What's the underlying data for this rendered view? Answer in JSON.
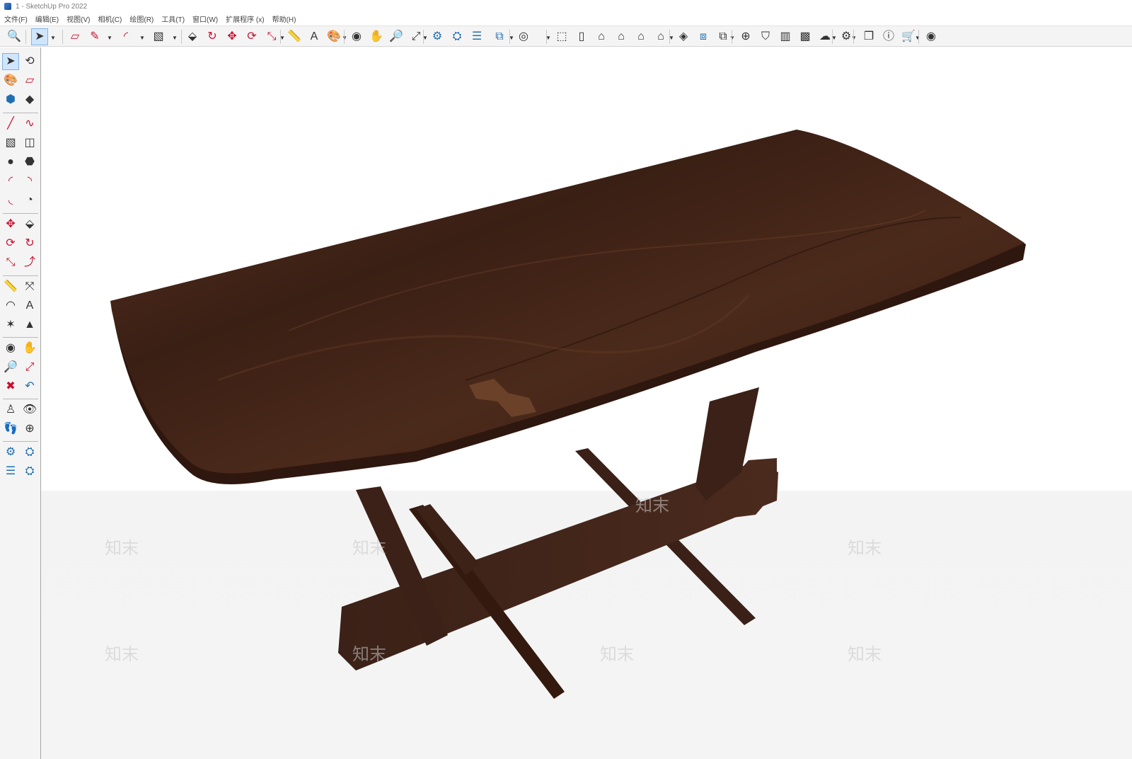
{
  "window": {
    "title": "1 - SketchUp Pro 2022"
  },
  "menu": [
    "文件(F)",
    "编辑(E)",
    "视图(V)",
    "相机(C)",
    "绘图(R)",
    "工具(T)",
    "窗口(W)",
    "扩展程序 (x)",
    "帮助(H)"
  ],
  "colors": {
    "toolbar_bg": "#f4f4f4",
    "active_tool": "#cfe5fb",
    "wood_top": "#4a2a1c",
    "wood_leg": "#3c2218",
    "icon_red": "#c8102e",
    "icon_blue": "#1f6fb2"
  },
  "toolbar": [
    {
      "icon": "zoom-extents-icon",
      "glyph": "🔍"
    },
    {
      "icon": "select-icon",
      "glyph": "➤"
    },
    {
      "icon": "eraser-icon",
      "glyph": "▱"
    },
    {
      "icon": "pencil-icon",
      "glyph": "✎"
    },
    {
      "icon": "arc-icon",
      "glyph": "◜"
    },
    {
      "icon": "rectangle-icon",
      "glyph": "▧"
    },
    {
      "icon": "push-pull-icon",
      "glyph": "⬙"
    },
    {
      "icon": "follow-me-icon",
      "glyph": "↻"
    },
    {
      "icon": "move-icon",
      "glyph": "✥"
    },
    {
      "icon": "rotate-icon",
      "glyph": "⟳"
    },
    {
      "icon": "scale-icon",
      "glyph": "⤡"
    },
    {
      "icon": "tape-measure-icon",
      "glyph": "📏"
    },
    {
      "icon": "text-icon",
      "glyph": "A"
    },
    {
      "icon": "paint-bucket-icon",
      "glyph": "🎨"
    },
    {
      "icon": "orbit-icon",
      "glyph": "◉"
    },
    {
      "icon": "pan-icon",
      "glyph": "✋"
    },
    {
      "icon": "zoom-icon",
      "glyph": "🔎"
    },
    {
      "icon": "zoom-window-icon",
      "glyph": "⤢"
    },
    {
      "icon": "warehouse-icon",
      "glyph": "⚙"
    },
    {
      "icon": "extension-warehouse-icon",
      "glyph": "⛭"
    },
    {
      "icon": "layout-icon",
      "glyph": "☰"
    },
    {
      "icon": "styles-icon",
      "glyph": "⧉"
    },
    {
      "icon": "account-icon",
      "glyph": "◎"
    },
    {
      "icon": "iso-view-icon",
      "glyph": "⬚"
    },
    {
      "icon": "front-view-icon",
      "glyph": "▯"
    },
    {
      "icon": "top-view-icon",
      "glyph": "⌂"
    },
    {
      "icon": "back-view-icon",
      "glyph": "⌂"
    },
    {
      "icon": "left-view-icon",
      "glyph": "⌂"
    },
    {
      "icon": "right-view-icon",
      "glyph": "⌂"
    },
    {
      "icon": "shadow-icon",
      "glyph": "◈"
    },
    {
      "icon": "section-plane-icon",
      "glyph": "⧈"
    },
    {
      "icon": "scenes-icon",
      "glyph": "⧉"
    },
    {
      "icon": "add-location-icon",
      "glyph": "⊕"
    },
    {
      "icon": "shield-icon",
      "glyph": "⛉"
    },
    {
      "icon": "materials-icon",
      "glyph": "▥"
    },
    {
      "icon": "checker-icon",
      "glyph": "▩"
    },
    {
      "icon": "cloud-icon",
      "glyph": "☁"
    },
    {
      "icon": "settings-icon",
      "glyph": "⚙"
    },
    {
      "icon": "outliner-icon",
      "glyph": "❐"
    },
    {
      "icon": "info-icon",
      "glyph": "ⓘ"
    },
    {
      "icon": "cart-icon",
      "glyph": "🛒"
    },
    {
      "icon": "user-icon",
      "glyph": "◉"
    }
  ],
  "left_tools": [
    {
      "icon": "select-icon",
      "glyph": "➤"
    },
    {
      "icon": "orbit-icon",
      "glyph": "⟲"
    },
    {
      "icon": "paint-bucket-icon",
      "glyph": "🎨"
    },
    {
      "icon": "eraser-icon",
      "glyph": "▱"
    },
    {
      "icon": "component-icon",
      "glyph": "⬢"
    },
    {
      "icon": "tag-icon",
      "glyph": "◆"
    },
    {
      "icon": "line-icon",
      "glyph": "╱"
    },
    {
      "icon": "freehand-icon",
      "glyph": "∿"
    },
    {
      "icon": "rectangle-icon",
      "glyph": "▧"
    },
    {
      "icon": "rotated-rectangle-icon",
      "glyph": "◫"
    },
    {
      "icon": "circle-icon",
      "glyph": "●"
    },
    {
      "icon": "polygon-icon",
      "glyph": "⬣"
    },
    {
      "icon": "arc-icon",
      "glyph": "◜"
    },
    {
      "icon": "two-point-arc-icon",
      "glyph": "◝"
    },
    {
      "icon": "three-point-arc-icon",
      "glyph": "◟"
    },
    {
      "icon": "pie-icon",
      "glyph": "◔"
    },
    {
      "icon": "move-icon",
      "glyph": "✥"
    },
    {
      "icon": "push-pull-icon",
      "glyph": "⬙"
    },
    {
      "icon": "rotate-icon",
      "glyph": "⟳"
    },
    {
      "icon": "follow-me-icon",
      "glyph": "↻"
    },
    {
      "icon": "scale-icon",
      "glyph": "⤡"
    },
    {
      "icon": "offset-icon",
      "glyph": "⤴"
    },
    {
      "icon": "tape-measure-icon",
      "glyph": "📏"
    },
    {
      "icon": "dimension-icon",
      "glyph": "⤧"
    },
    {
      "icon": "protractor-icon",
      "glyph": "◠"
    },
    {
      "icon": "text-icon",
      "glyph": "A"
    },
    {
      "icon": "axes-icon",
      "glyph": "✶"
    },
    {
      "icon": "3d-text-icon",
      "glyph": "▲"
    },
    {
      "icon": "orbit-icon",
      "glyph": "◉"
    },
    {
      "icon": "pan-icon",
      "glyph": "✋"
    },
    {
      "icon": "zoom-icon",
      "glyph": "🔎"
    },
    {
      "icon": "zoom-window-icon",
      "glyph": "⤢"
    },
    {
      "icon": "zoom-extents-icon",
      "glyph": "✖"
    },
    {
      "icon": "previous-view-icon",
      "glyph": "↶"
    },
    {
      "icon": "position-camera-icon",
      "glyph": "♙"
    },
    {
      "icon": "look-around-icon",
      "glyph": "👁"
    },
    {
      "icon": "walk-icon",
      "glyph": "👣"
    },
    {
      "icon": "section-plane-icon",
      "glyph": "⊕"
    },
    {
      "icon": "warehouse-icon",
      "glyph": "⚙"
    },
    {
      "icon": "extension-warehouse-icon",
      "glyph": "⛭"
    },
    {
      "icon": "layout-icon",
      "glyph": "☰"
    },
    {
      "icon": "extension-manager-icon",
      "glyph": "⛭"
    }
  ],
  "viewport": {
    "watermark": "知末"
  }
}
